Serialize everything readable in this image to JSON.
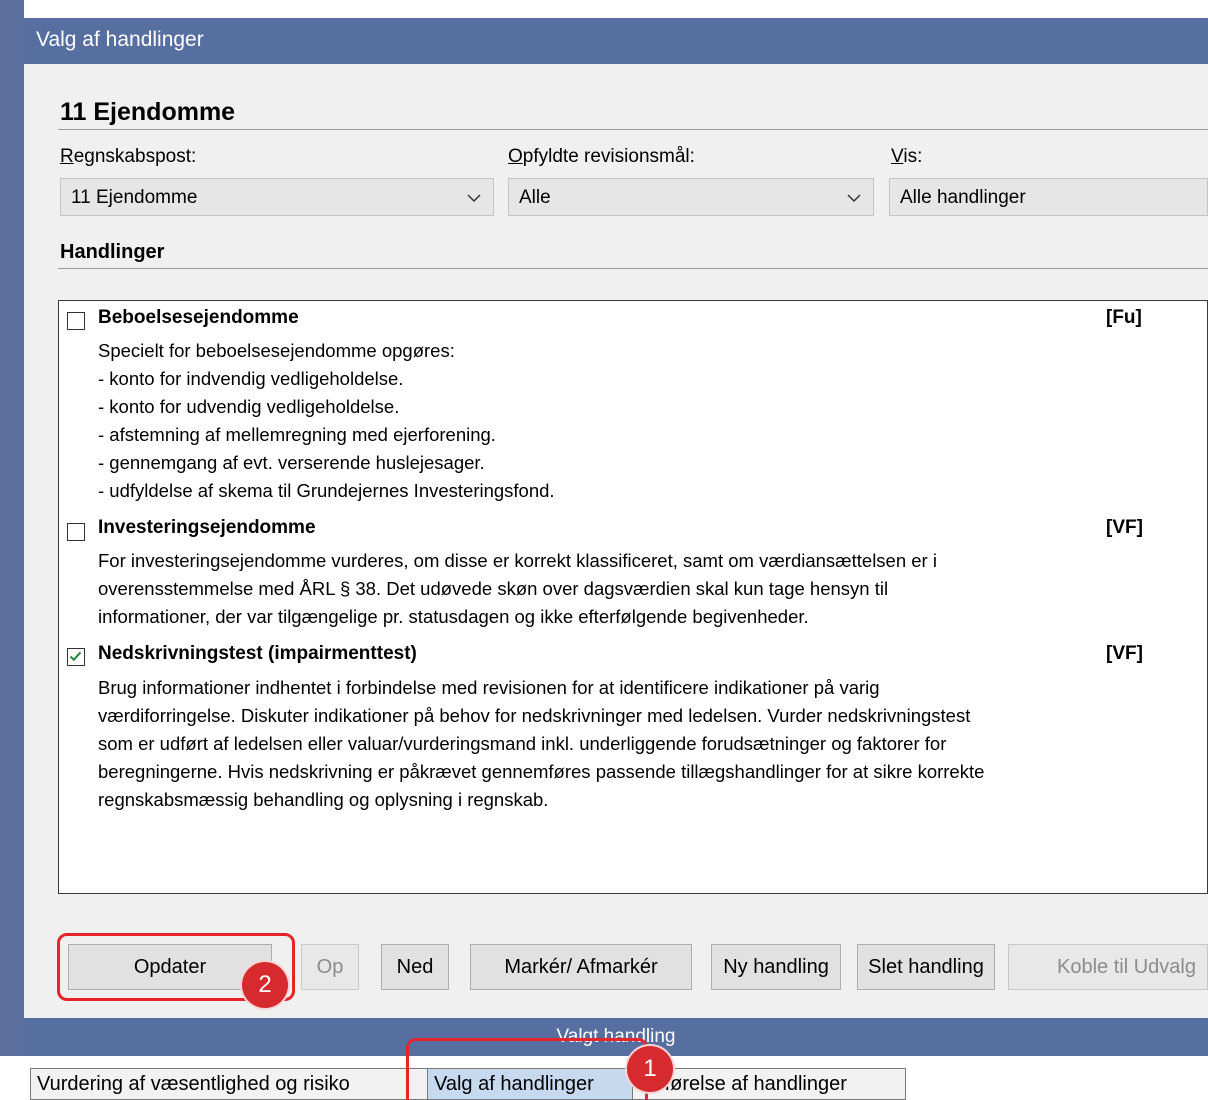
{
  "window": {
    "title": "Valg af handlinger"
  },
  "section": {
    "title": "11 Ejendomme",
    "list_header": "Handlinger"
  },
  "filters": {
    "regnskabspost_label": "Regnskabspost:",
    "regnskabspost_value": "11 Ejendomme",
    "revisionsmaal_label": "Opfyldte revisionsmål:",
    "revisionsmaal_value": "Alle",
    "vis_label": "Vis:",
    "vis_value": "Alle handlinger"
  },
  "items": [
    {
      "title": "Beboelsesejendomme",
      "tag": "[Fu]",
      "checked": false,
      "desc": "Specielt for beboelsesejendomme opgøres:\n- konto for indvendig vedligeholdelse.\n- konto for udvendig vedligeholdelse.\n- afstemning af mellemregning med ejerforening.\n- gennemgang af evt. verserende huslejesager.\n- udfyldelse af skema til Grundejernes Investeringsfond."
    },
    {
      "title": "Investeringsejendomme",
      "tag": "[VF]",
      "checked": false,
      "desc": "For investeringsejendomme vurderes, om disse er korrekt klassificeret, samt om værdiansættelsen er i\noverensstemmelse med ÅRL § 38. Det udøvede skøn over dagsværdien skal kun tage hensyn til\ninformationer, der var tilgængelige pr. statusdagen og ikke efterfølgende begivenheder."
    },
    {
      "title": "Nedskrivningstest (impairmenttest)",
      "tag": "[VF]",
      "checked": true,
      "desc": "Brug informationer indhentet i forbindelse med revisionen for at identificere indikationer på varig\nværdiforringelse. Diskuter indikationer på behov for nedskrivninger med ledelsen. Vurder nedskrivningstest\nsom er udført af ledelsen eller valuar/vurderingsmand inkl. underliggende forudsætninger og faktorer for\nberegningerne. Hvis nedskrivning er påkrævet gennemføres passende tillægshandlinger for at sikre korrekte\nregnskabsmæssig behandling og oplysning i regnskab."
    }
  ],
  "buttons": {
    "opdater": "Opdater",
    "op": "Op",
    "ned": "Ned",
    "marker": "Markér/ Afmarkér",
    "ny": "Ny handling",
    "slet": "Slet handling",
    "koble": "Koble til Udvalg"
  },
  "status_bar": {
    "text": "Valgt handling"
  },
  "tabs": [
    {
      "label": "Vurdering af væsentlighed og risiko",
      "active": false
    },
    {
      "label": "Valg af handlinger",
      "active": true
    },
    {
      "label": "Udførelse af handlinger",
      "active": false
    }
  ],
  "annotations": {
    "badge1": "1",
    "badge2": "2"
  },
  "colors": {
    "titlebar": "#566fa0",
    "highlight": "#e8242b",
    "checkmark": "#1e8c2e"
  }
}
